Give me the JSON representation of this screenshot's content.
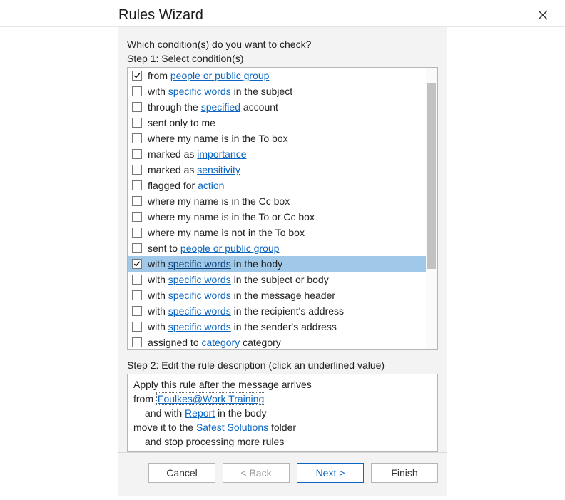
{
  "title": "Rules Wizard",
  "question": "Which condition(s) do you want to check?",
  "step1_label": "Step 1: Select condition(s)",
  "step2_label": "Step 2: Edit the rule description (click an underlined value)",
  "conditions": [
    {
      "checked": true,
      "selected": false,
      "parts": [
        {
          "t": "from "
        },
        {
          "t": "people or public group",
          "link": true
        }
      ]
    },
    {
      "checked": false,
      "selected": false,
      "parts": [
        {
          "t": "with "
        },
        {
          "t": "specific words",
          "link": true
        },
        {
          "t": " in the subject"
        }
      ]
    },
    {
      "checked": false,
      "selected": false,
      "parts": [
        {
          "t": "through the "
        },
        {
          "t": "specified",
          "link": true
        },
        {
          "t": " account"
        }
      ]
    },
    {
      "checked": false,
      "selected": false,
      "parts": [
        {
          "t": "sent only to me"
        }
      ]
    },
    {
      "checked": false,
      "selected": false,
      "parts": [
        {
          "t": "where my name is in the To box"
        }
      ]
    },
    {
      "checked": false,
      "selected": false,
      "parts": [
        {
          "t": "marked as "
        },
        {
          "t": "importance",
          "link": true
        }
      ]
    },
    {
      "checked": false,
      "selected": false,
      "parts": [
        {
          "t": "marked as "
        },
        {
          "t": "sensitivity",
          "link": true
        }
      ]
    },
    {
      "checked": false,
      "selected": false,
      "parts": [
        {
          "t": "flagged for "
        },
        {
          "t": "action",
          "link": true
        }
      ]
    },
    {
      "checked": false,
      "selected": false,
      "parts": [
        {
          "t": "where my name is in the Cc box"
        }
      ]
    },
    {
      "checked": false,
      "selected": false,
      "parts": [
        {
          "t": "where my name is in the To or Cc box"
        }
      ]
    },
    {
      "checked": false,
      "selected": false,
      "parts": [
        {
          "t": "where my name is not in the To box"
        }
      ]
    },
    {
      "checked": false,
      "selected": false,
      "parts": [
        {
          "t": "sent to "
        },
        {
          "t": "people or public group",
          "link": true
        }
      ]
    },
    {
      "checked": true,
      "selected": true,
      "parts": [
        {
          "t": "with "
        },
        {
          "t": "specific words",
          "link": true
        },
        {
          "t": " in the body"
        }
      ]
    },
    {
      "checked": false,
      "selected": false,
      "parts": [
        {
          "t": "with "
        },
        {
          "t": "specific words",
          "link": true
        },
        {
          "t": " in the subject or body"
        }
      ]
    },
    {
      "checked": false,
      "selected": false,
      "parts": [
        {
          "t": "with "
        },
        {
          "t": "specific words",
          "link": true
        },
        {
          "t": " in the message header"
        }
      ]
    },
    {
      "checked": false,
      "selected": false,
      "parts": [
        {
          "t": "with "
        },
        {
          "t": "specific words",
          "link": true
        },
        {
          "t": " in the recipient's address"
        }
      ]
    },
    {
      "checked": false,
      "selected": false,
      "parts": [
        {
          "t": "with "
        },
        {
          "t": "specific words",
          "link": true
        },
        {
          "t": " in the sender's address"
        }
      ]
    },
    {
      "checked": false,
      "selected": false,
      "parts": [
        {
          "t": "assigned to "
        },
        {
          "t": "category",
          "link": true
        },
        {
          "t": " category"
        }
      ]
    }
  ],
  "description": {
    "line1": "Apply this rule after the message arrives",
    "line2_a": "from ",
    "line2_link": "Foulkes@Work Training",
    "line3_a": "and with ",
    "line3_link": "Report",
    "line3_b": " in the body",
    "line4_a": "move it to the ",
    "line4_link": "Safest Solutions",
    "line4_b": " folder",
    "line5": "and stop processing more rules"
  },
  "buttons": {
    "cancel": "Cancel",
    "back": "< Back",
    "next": "Next >",
    "finish": "Finish"
  }
}
